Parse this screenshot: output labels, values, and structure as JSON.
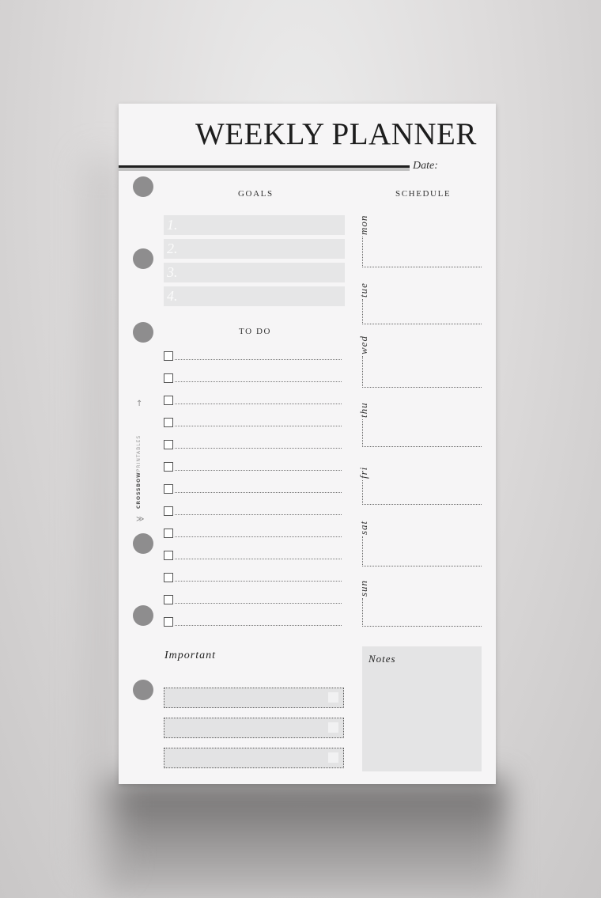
{
  "header": {
    "title": "WEEKLY PLANNER",
    "date_label": "Date:"
  },
  "goals": {
    "heading": "GOALS",
    "items": [
      {
        "number": "1.",
        "value": ""
      },
      {
        "number": "2.",
        "value": ""
      },
      {
        "number": "3.",
        "value": ""
      },
      {
        "number": "4.",
        "value": ""
      }
    ]
  },
  "todo": {
    "heading": "TO DO",
    "items": [
      "",
      "",
      "",
      "",
      "",
      "",
      "",
      "",
      "",
      "",
      "",
      "",
      ""
    ]
  },
  "schedule": {
    "heading": "SCHEDULE",
    "days": [
      "mon",
      "tue",
      "wed",
      "thu",
      "fri",
      "sat",
      "sun"
    ]
  },
  "important": {
    "label": "Important",
    "items": [
      "",
      "",
      ""
    ]
  },
  "notes": {
    "label": "Notes"
  },
  "branding": {
    "bold": "CROSSBOW",
    "light": "PRINTABLES",
    "arrow_top_icon": "arrow-head-icon",
    "arrow_bottom_icon": "arrow-fletching-icon"
  },
  "colors": {
    "paper": "#f6f5f6",
    "field_fill": "#e6e6e7",
    "hole": "#8e8d8e",
    "ink": "#1d1d1d"
  }
}
